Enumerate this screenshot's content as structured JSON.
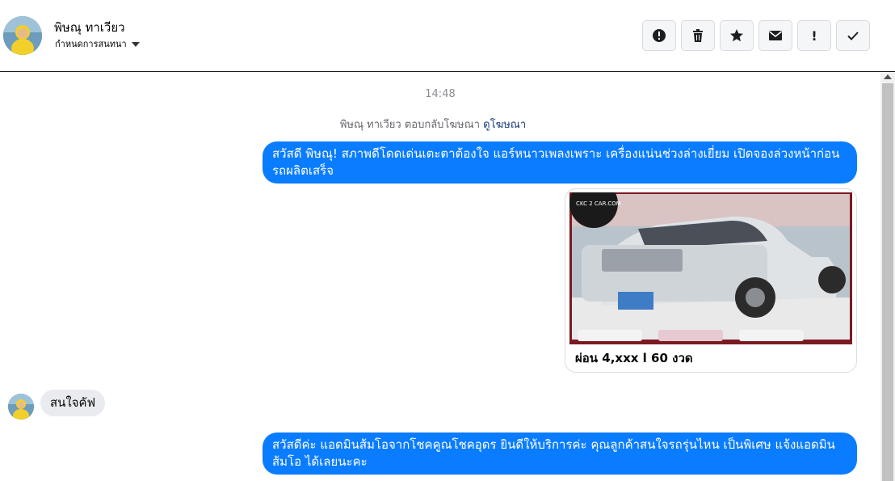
{
  "header": {
    "contact_name": "พิษณุ ทาเวียว",
    "subtitle": "กำหนดการสนทนา",
    "actions": [
      {
        "icon": "alert-circle-icon",
        "name": "report-button"
      },
      {
        "icon": "trash-icon",
        "name": "delete-button"
      },
      {
        "icon": "star-icon",
        "name": "star-button"
      },
      {
        "icon": "envelope-icon",
        "name": "mark-unread-button"
      },
      {
        "icon": "exclamation-icon",
        "name": "important-button"
      },
      {
        "icon": "check-icon",
        "name": "done-button"
      }
    ]
  },
  "conversation": {
    "timestamp": "14:48",
    "reply_note": "พิษณุ ทาเวียว ตอบกลับโฆษณา",
    "reply_link": "ดูโฆษณา",
    "messages": [
      {
        "from": "page",
        "text_line1": "สวัสดี พิษณุ! สภาพดีโดดเด่นเตะตาต้องใจ แอร์หนาวเพลงเพราะ เครื่องแน่นช่วงล่างเยี่ยม เปิดจองล่วงหน้าก่อน",
        "text_line2": "รถผลิตเสร็จ"
      },
      {
        "from": "page",
        "type": "ad_card",
        "caption": "ผ่อน 4,xxx l 60 งวด",
        "watermark": "CKC 2 CAR.COM"
      },
      {
        "from": "user",
        "text": "สนใจคัฟ"
      },
      {
        "from": "page",
        "text_line1": "สวัสดีค่ะ แอดมินส้มโอจากโชคคูณโชคอุดร ยินดีให้บริการค่ะ   คุณลูกค้าสนใจรถรุ่นไหน เป็นพิเศษ แจ้งแอดมิน",
        "text_line2": "ส้มโอ ได้เลยนะคะ"
      }
    ]
  },
  "colors": {
    "outgoing_bubble": "#0a7cff",
    "incoming_bubble": "#e9ebee",
    "link": "#1a3a7a"
  }
}
